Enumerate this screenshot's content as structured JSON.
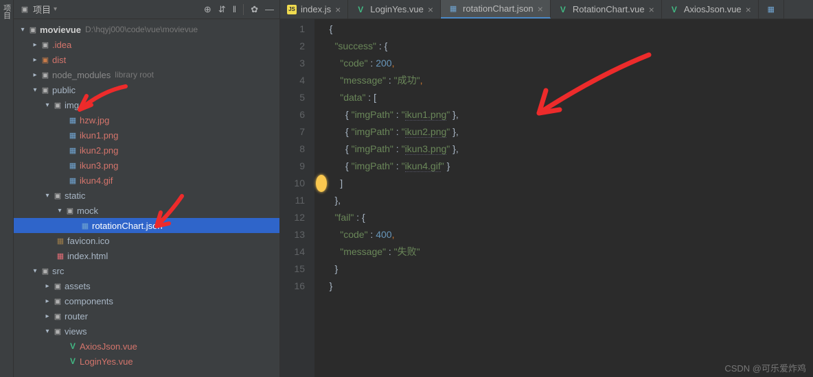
{
  "leftGutter": "项目",
  "sidebar": {
    "title": "项目",
    "tools": [
      "⊕",
      "⇵",
      "‖",
      "✿",
      "—"
    ]
  },
  "tree": {
    "root": {
      "name": "movievue",
      "path": "D:\\hqyj000\\code\\vue\\movievue"
    },
    "idea": ".idea",
    "dist": "dist",
    "node_modules": "node_modules",
    "lib_hint": "library root",
    "public": "public",
    "img": "img",
    "files_img": [
      "hzw.jpg",
      "ikun1.png",
      "ikun2.png",
      "ikun3.png",
      "ikun4.gif"
    ],
    "static": "static",
    "mock": "mock",
    "rotation": "rotationChart.json",
    "favicon": "favicon.ico",
    "indexhtml": "index.html",
    "src": "src",
    "assets": "assets",
    "components": "components",
    "router": "router",
    "views": "views",
    "views_files": [
      "AxiosJson.vue",
      "LoginYes.vue"
    ]
  },
  "tabs": [
    {
      "label": "index.js",
      "type": "js"
    },
    {
      "label": "LoginYes.vue",
      "type": "vue"
    },
    {
      "label": "rotationChart.json",
      "type": "json",
      "active": true
    },
    {
      "label": "RotationChart.vue",
      "type": "vue"
    },
    {
      "label": "AxiosJson.vue",
      "type": "vue"
    }
  ],
  "code": {
    "l1": "{",
    "l2a": "\"success\"",
    "l2b": " : {",
    "l3a": "\"code\"",
    "l3b": " : ",
    "l3c": "200",
    "l3d": ",",
    "l4a": "\"message\"",
    "l4b": " : ",
    "l4c": "\"成功\"",
    "l4d": ",",
    "l5a": "\"data\"",
    "l5b": " : [",
    "l6a": "{ ",
    "l6b": "\"imgPath\"",
    "l6c": " : ",
    "l6d": "\"",
    "l6e": "ikun1.png",
    "l6f": "\"",
    "l6g": " },",
    "l7e": "ikun2.png",
    "l8e": "ikun3.png",
    "l9e": "ikun4.gif",
    "l9g": " }",
    "l10": "]",
    "l11": "},",
    "l12a": "\"fail\"",
    "l12b": " : {",
    "l13a": "\"code\"",
    "l13b": " : ",
    "l13c": "400",
    "l13d": ",",
    "l14a": "\"message\"",
    "l14b": " : ",
    "l14c": "\"失败\"",
    "l15": "}",
    "l16": "}"
  },
  "lines": [
    "1",
    "2",
    "3",
    "4",
    "5",
    "6",
    "7",
    "8",
    "9",
    "10",
    "11",
    "12",
    "13",
    "14",
    "15",
    "16"
  ],
  "watermark": "CSDN @可乐爱炸鸡"
}
